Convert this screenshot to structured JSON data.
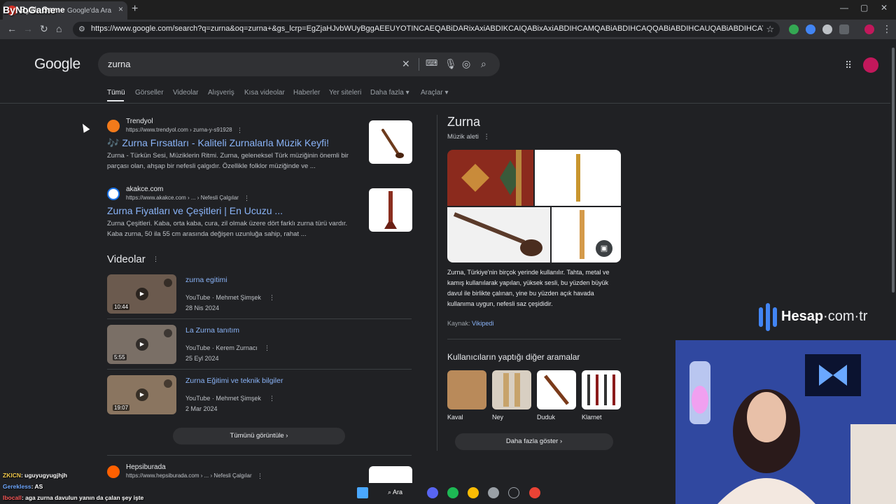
{
  "browser": {
    "tab_label": "ByNoGame",
    "tab_subtitle": "Google'da Ara",
    "close_tab": "×",
    "new_tab": "+",
    "url": "https://www.google.com/search?q=zurna&oq=zurna+&gs_lcrp=EgZjaHJvbWUyBggAEEUYOTINCAEQABiDARixAxiABDIKCAIQABixAxiABDIHCAMQABiABDIHCAQQABiABDIHCAUQABiABDIHCAYQABiABDINCAcQLhivARjHARiABDIHCA..."
  },
  "google": {
    "logo": "Google",
    "query": "zurna",
    "tabs": [
      "Tümü",
      "Görseller",
      "Videolar",
      "Alışveriş",
      "Kısa videolar",
      "Haberler",
      "Yer siteleri",
      "Daha fazla",
      "Araçlar"
    ]
  },
  "results": [
    {
      "site": "Trendyol",
      "url": "https://www.trendyol.com › zurna-y-s91928",
      "title": "🎶 Zurna Fırsatları - Kaliteli Zurnalarla Müzik Keyfi!",
      "snippet": "Zurna - Türkün Sesi, Müziklerin Ritmi. Zurna, geleneksel Türk müziğinin önemli bir parçası olan, ahşap bir nefesli çalgıdır. Özellikle folklor müziğinde ve ..."
    },
    {
      "site": "akakce.com",
      "url": "https://www.akakce.com › ... › Nefesli Çalgılar",
      "title": "Zurna Fiyatları ve Çeşitleri | En Ucuzu ...",
      "snippet": "Zurna Çeşitleri. Kaba, orta kaba, cura, zil olmak üzere dört farklı zurna türü vardır. Kaba zurna, 50 ila 55 cm arasında değişen uzunluğa sahip, rahat ..."
    },
    {
      "site": "Hepsiburada",
      "url": "https://www.hepsiburada.com › ... › Nefesli Çalgılar"
    }
  ],
  "videos": {
    "heading": "Videolar",
    "items": [
      {
        "title": "zurna egitimi",
        "source": "YouTube · Mehmet Şimşek",
        "date": "28 Nis 2024",
        "duration": "10:44"
      },
      {
        "title": "La Zurna tanıtım",
        "source": "YouTube · Kerem Zurnacı",
        "date": "25 Eyl 2024",
        "duration": "5:55"
      },
      {
        "title": "Zurna Eğitimi ve teknik bilgiler",
        "source": "YouTube · Mehmet Şimşek",
        "date": "2 Mar 2024",
        "duration": "19:07"
      }
    ],
    "see_all": "Tümünü görüntüle"
  },
  "knowledge_panel": {
    "title": "Zurna",
    "subtitle": "Müzik aleti",
    "description": "Zurna, Türkiye'nin birçok yerinde kullanılır. Tahta, metal ve kamış kullanılarak yapılan, yüksek sesli, bu yüzden büyük davul ile birlikte çalınan, yine bu yüzden açık havada kullanıma uygun, nefesli saz çeşididir.",
    "source_label": "Kaynak:",
    "source_link": "Vikipedi",
    "related_heading": "Kullanıcıların yaptığı diğer aramalar",
    "related": [
      "Kaval",
      "Ney",
      "Duduk",
      "Klarnet"
    ],
    "more": "Daha fazla göster"
  },
  "overlay": {
    "watermark_bold": "Hesap",
    "watermark_rest": "·com·tr",
    "chat": [
      {
        "user": "ZKICN",
        "msg": ": uguyugyugjhjh"
      },
      {
        "user": "Gerekless",
        "msg": ": AS"
      },
      {
        "user": "lbocall",
        "msg": ": aga zurna davulun yanın da çalan şey işte"
      }
    ],
    "taskbar_search": "Ara"
  }
}
